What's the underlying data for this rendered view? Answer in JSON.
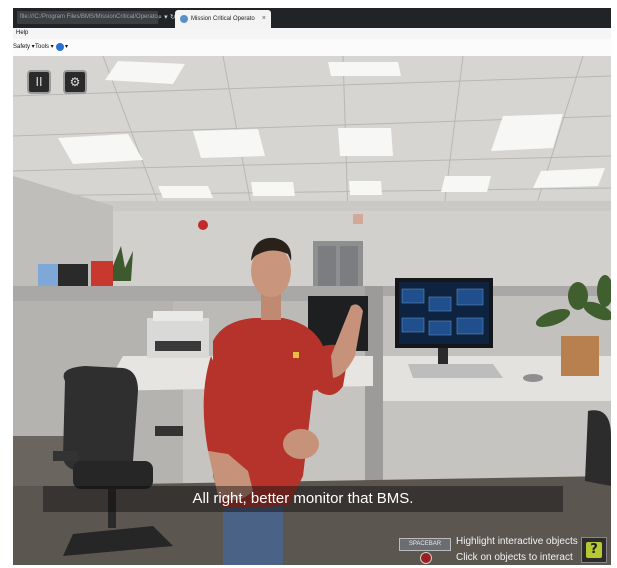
{
  "browser": {
    "address": "file:///C:/Program Files/BMS/MissionCritical/Operator",
    "address_controls": "⌕ ▾ ↻",
    "tab_title": "Mission Critical Operato",
    "tab_close": "×"
  },
  "menu": {
    "help": "Help",
    "safety": "Safety ▾",
    "tools": "Tools ▾",
    "help_icon": "▾"
  },
  "controls": {
    "pause": "II",
    "settings": "⚙"
  },
  "monitor_screen": {
    "tiles": [
      "Server Room",
      "Battery Room",
      "Generator Room",
      "UPS Room",
      "Switch Room",
      "Chiller Plant"
    ]
  },
  "subtitle": "All right, better monitor that BMS.",
  "hints": {
    "key_label": "SPACEBAR",
    "highlight": "Highlight interactive objects",
    "click": "Click on objects to interact"
  },
  "help_button": "?",
  "colors": {
    "shirt": "#b5332a",
    "help_accent": "#b7c932",
    "monitor_tile": "#1f4f8c"
  }
}
